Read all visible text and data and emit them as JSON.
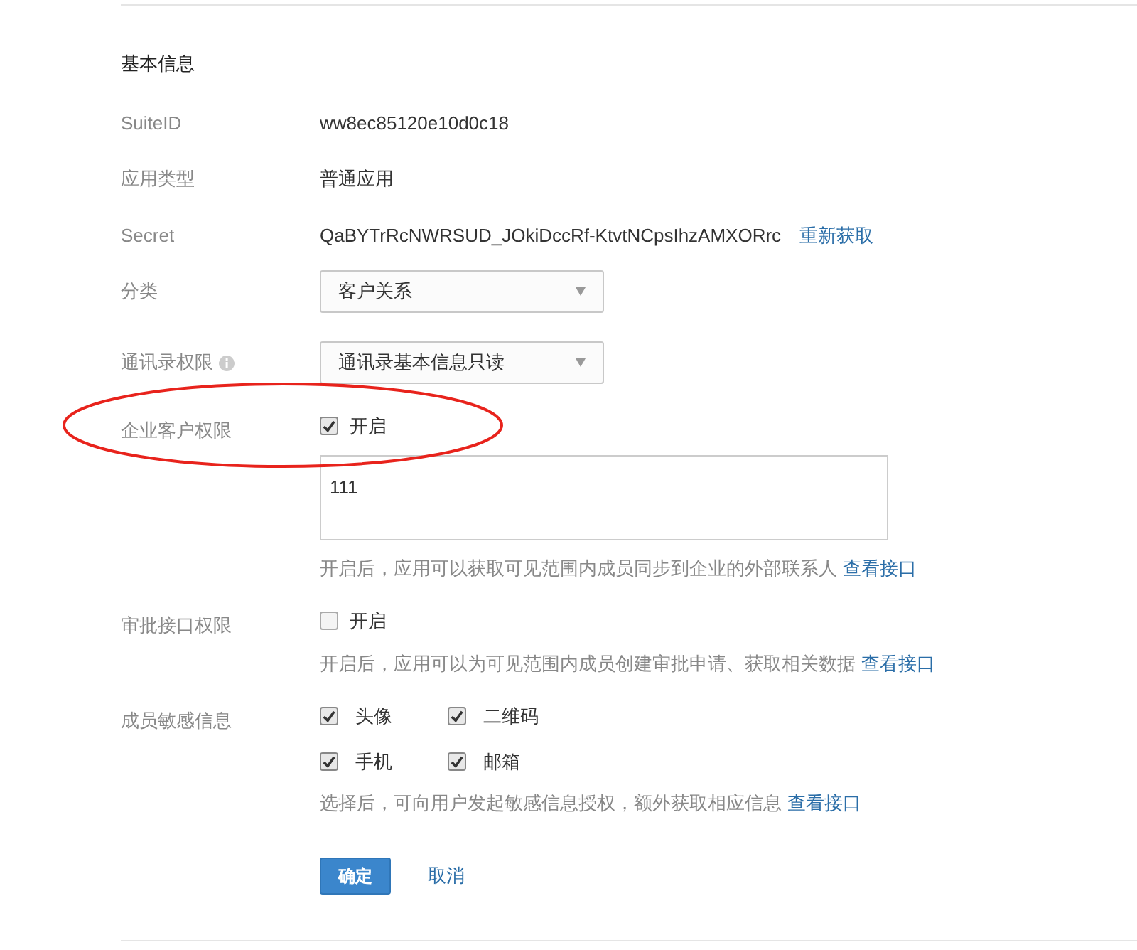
{
  "section_title": "基本信息",
  "rows": [
    {
      "kind": "text",
      "label": "SuiteID",
      "value": "ww8ec85120e10d0c18"
    },
    {
      "kind": "text",
      "label": "应用类型",
      "value": "普通应用"
    },
    {
      "kind": "secret",
      "label": "Secret",
      "value": "QaBYTrRcNWRSUD_JOkiDccRf-KtvtNCpsIhzAMXORrc",
      "link": "重新获取"
    },
    {
      "kind": "select",
      "label": "分类",
      "value": "客户关系"
    },
    {
      "kind": "select",
      "label": "通讯录权限",
      "value": "通讯录基本信息只读",
      "info": true
    },
    {
      "kind": "toggle",
      "label": "企业客户权限",
      "option": "开启",
      "checked": true,
      "textarea": "111",
      "hint": "开启后，应用可以获取可见范围内成员同步到企业的外部联系人",
      "link": "查看接口"
    },
    {
      "kind": "toggle",
      "label": "审批接口权限",
      "option": "开启",
      "checked": false,
      "hint": "开启后，应用可以为可见范围内成员创建审批申请、获取相关数据",
      "link": "查看接口"
    },
    {
      "kind": "checks",
      "label": "成员敏感信息",
      "options": [
        {
          "label": "头像",
          "checked": true
        },
        {
          "label": "二维码",
          "checked": true
        },
        {
          "label": "手机",
          "checked": true
        },
        {
          "label": "邮箱",
          "checked": true
        }
      ],
      "hint": "选择后，可向用户发起敏感信息授权，额外获取相应信息",
      "link": "查看接口"
    }
  ],
  "buttons": {
    "confirm": "确定",
    "cancel": "取消"
  }
}
